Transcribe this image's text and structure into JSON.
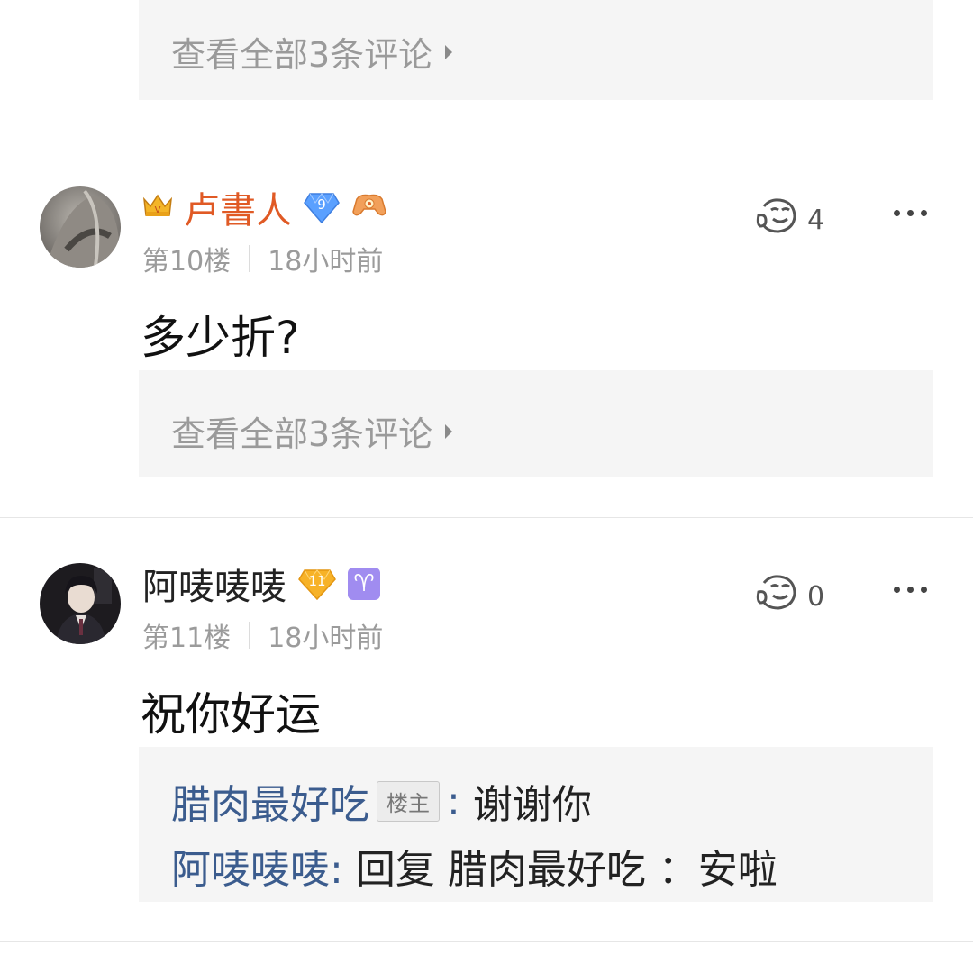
{
  "prev_post": {
    "view_all": "查看全部3条评论"
  },
  "posts": [
    {
      "username": "卢書人",
      "level_badge": "9",
      "floor": "第10楼",
      "time": "18小时前",
      "content": "多少折?",
      "like_count": "4",
      "view_all": "查看全部3条评论",
      "icons": [
        "crown-icon",
        "level-diamond-icon",
        "game-controller-icon"
      ]
    },
    {
      "username": "阿唛唛唛",
      "level_badge": "11",
      "zodiac": "♈",
      "floor": "第11楼",
      "time": "18小时前",
      "content": "祝你好运",
      "like_count": "0",
      "replies": [
        {
          "name": "腊肉最好吃",
          "tag": "楼主",
          "colon": ":",
          "text": "谢谢你"
        },
        {
          "name": "阿唛唛唛:",
          "text": "回复 腊肉最好吃 ：安啦"
        }
      ]
    }
  ],
  "colors": {
    "vip_name": "#e05a25",
    "reply_name": "#3b5c8e",
    "level_blue": "#4a8ff7",
    "level_gold": "#f5b025",
    "zodiac_purple": "#a08cf0"
  }
}
